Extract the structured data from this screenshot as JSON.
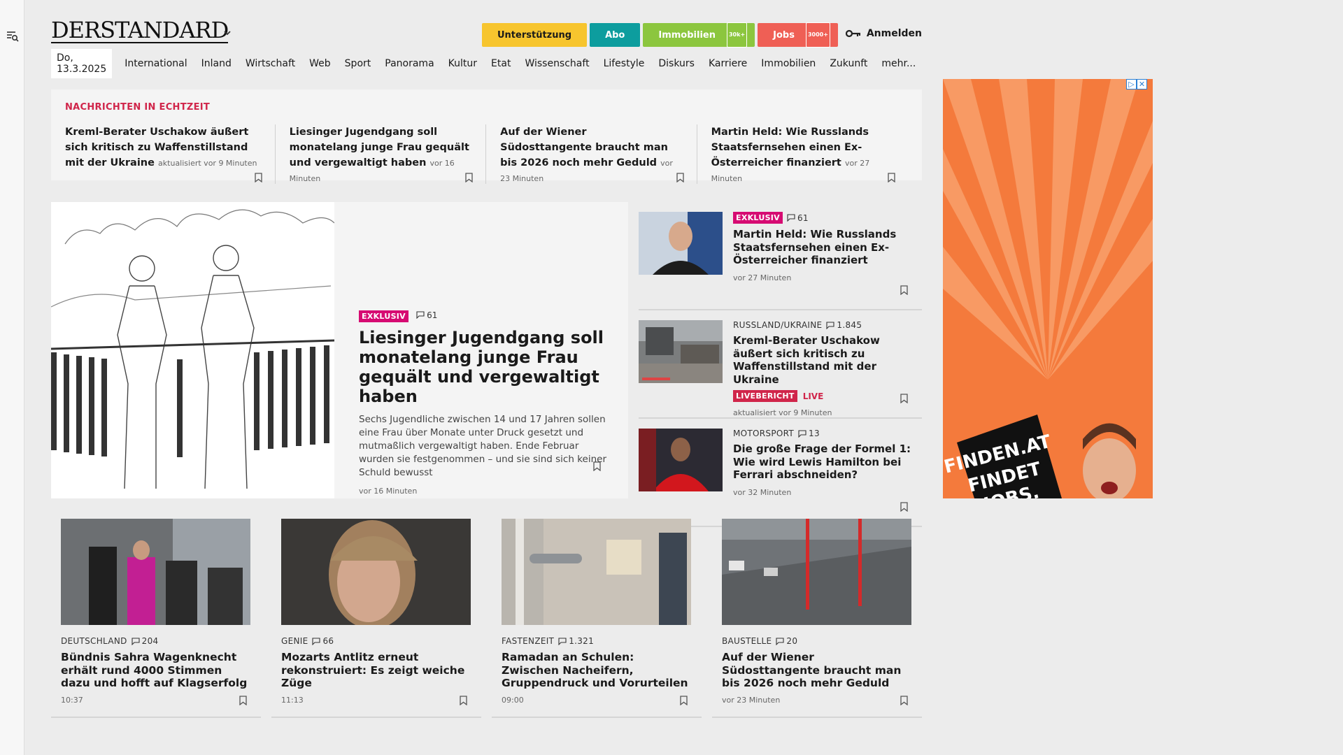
{
  "header": {
    "logo": "DERSTANDARD",
    "promo": {
      "support": "Unterstützung",
      "abo": "Abo",
      "immobilien": "Immobilien",
      "immobilien_badge": "30k+",
      "jobs": "Jobs",
      "jobs_badge": "3000+"
    },
    "login": "Anmelden"
  },
  "nav": {
    "date": "Do, 13.3.2025",
    "items": [
      "International",
      "Inland",
      "Wirtschaft",
      "Web",
      "Sport",
      "Panorama",
      "Kultur",
      "Etat",
      "Wissenschaft",
      "Lifestyle",
      "Diskurs",
      "Karriere",
      "Immobilien",
      "Zukunft",
      "mehr..."
    ]
  },
  "ticker": {
    "title": "NACHRICHTEN IN ECHTZEIT",
    "items": [
      {
        "headline": "Kreml-Berater Uschakow äußert sich kritisch zu Waffenstillstand mit der Ukraine",
        "meta": "aktualisiert vor 9 Minuten"
      },
      {
        "headline": "Liesinger Jugendgang soll monatelang junge Frau gequält und vergewaltigt haben",
        "meta": "vor 16 Minuten"
      },
      {
        "headline": "Auf der Wiener Südosttangente braucht man bis 2026 noch mehr Geduld",
        "meta": "vor 23 Minuten"
      },
      {
        "headline": "Martin Held: Wie Russlands Staatsfernsehen einen Ex-Österreicher finanziert",
        "meta": "vor 27 Minuten"
      }
    ]
  },
  "lead": {
    "badge": "EXKLUSIV",
    "comments": "61",
    "title": "Liesinger Jugendgang soll monatelang junge Frau gequält und vergewaltigt haben",
    "teaser": "Sechs Jugendliche zwischen 14 und 17 Jahren sollen eine Frau über Monate unter Druck gesetzt und mutmaßlich vergewaltigt haben. Ende Februar wurden sie festgenommen – und sie sind sich keiner Schuld bewusst",
    "time": "vor 16 Minuten"
  },
  "side": [
    {
      "badge": "EXKLUSIV",
      "comments": "61",
      "title": "Martin Held: Wie Russlands Staatsfernsehen einen Ex-Österreicher finanziert",
      "meta": "vor 27 Minuten"
    },
    {
      "kicker": "RUSSLAND/UKRAINE",
      "comments": "1.845",
      "title": "Kreml-Berater Uschakow äußert sich kritisch zu Waffenstillstand mit der Ukraine",
      "live_badge": "LIVEBERICHT",
      "live_label": "LIVE",
      "meta": "aktualisiert vor 9 Minuten"
    },
    {
      "kicker": "MOTORSPORT",
      "comments": "13",
      "title": "Die große Frage der Formel 1: Wie wird Lewis Hamilton bei Ferrari abschneiden?",
      "meta": "vor 32 Minuten"
    }
  ],
  "cards": [
    {
      "kicker": "DEUTSCHLAND",
      "comments": "204",
      "title": "Bündnis Sahra Wagenknecht erhält rund 4000 Stimmen dazu und hofft auf Klagserfolg",
      "time": "10:37"
    },
    {
      "kicker": "GENIE",
      "comments": "66",
      "title": "Mozarts Antlitz erneut rekonstruiert: Es zeigt weiche Züge",
      "time": "11:13"
    },
    {
      "kicker": "FASTENZEIT",
      "comments": "1.321",
      "title": "Ramadan an Schulen: Zwischen Nacheifern, Gruppendruck und Vorurteilen",
      "time": "09:00"
    },
    {
      "kicker": "BAUSTELLE",
      "comments": "20",
      "title": "Auf der Wiener Südosttangente braucht man bis 2026 noch mehr Geduld",
      "time": "vor 23 Minuten"
    }
  ],
  "ad": {
    "text_line1": "FINDEN.AT",
    "text_line2": "FINDET",
    "text_line3": "JOBS.",
    "bg_color": "#f47a3c"
  }
}
